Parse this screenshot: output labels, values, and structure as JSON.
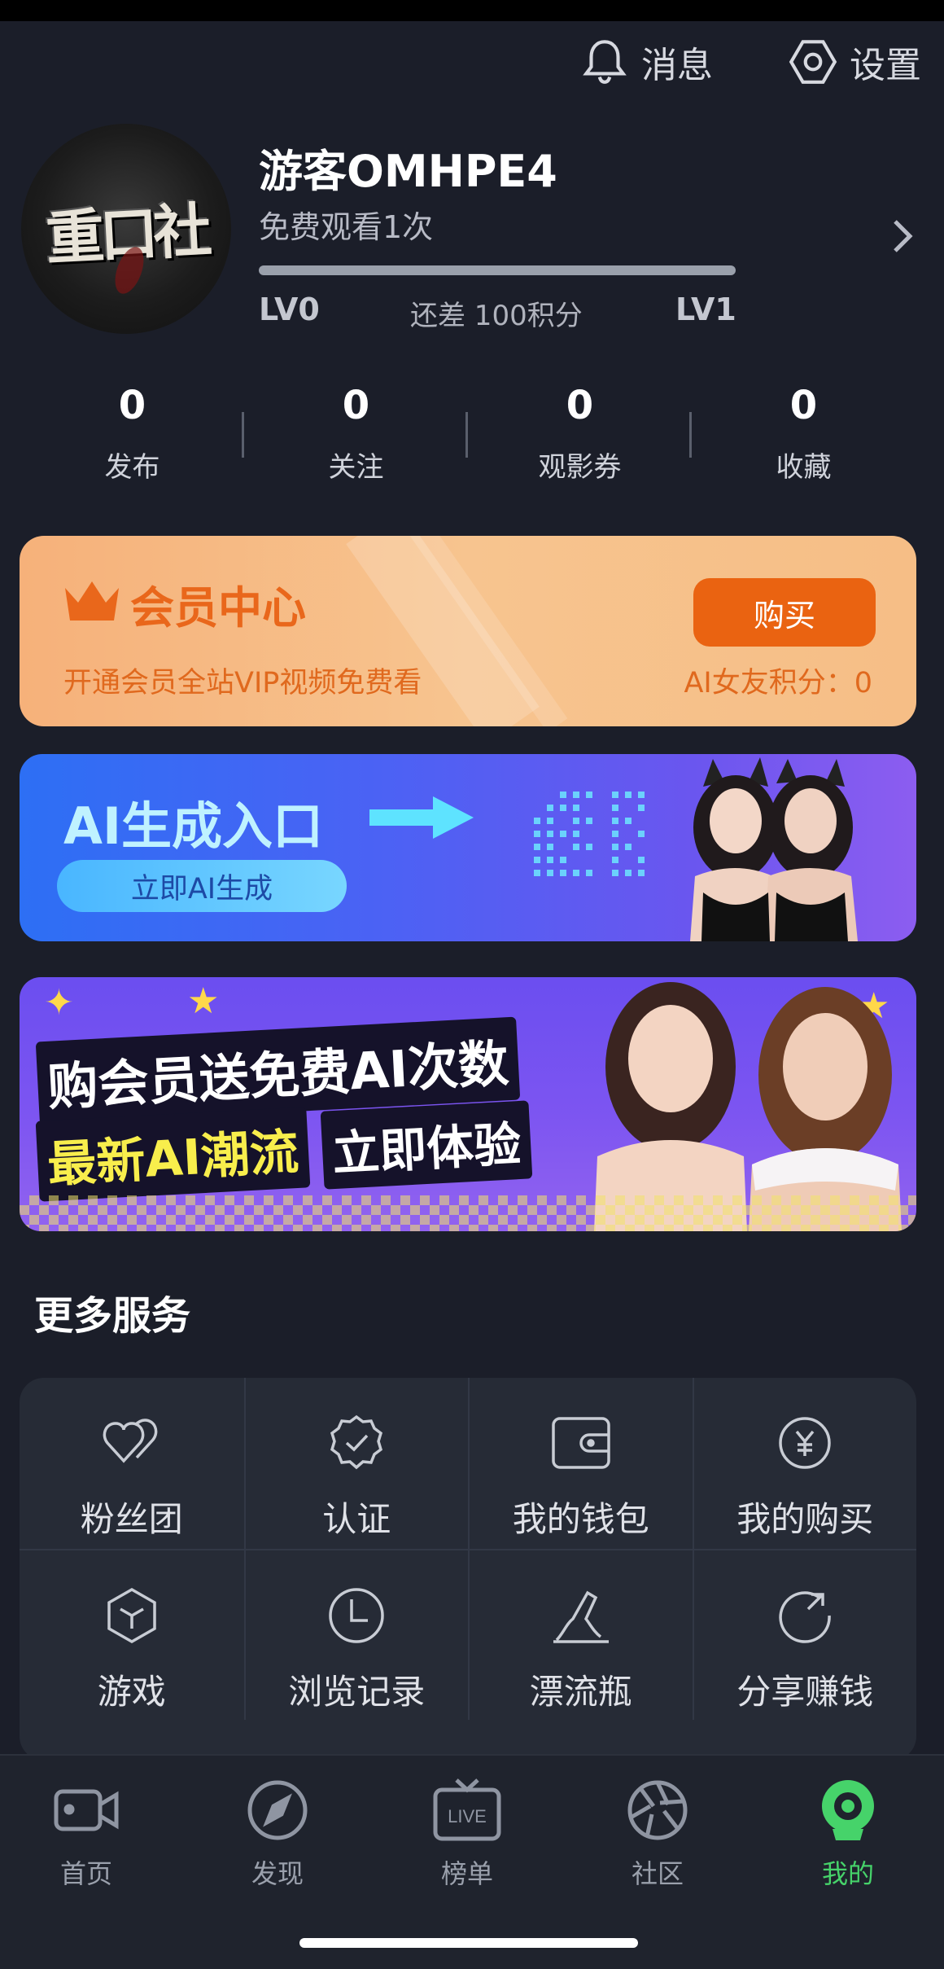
{
  "header": {
    "messages_label": "消息",
    "settings_label": "设置"
  },
  "profile": {
    "username": "游客OMHPE4",
    "free_views": "免费观看1次",
    "level_current": "LV0",
    "level_next": "LV1",
    "points_needed": "还差 100积分",
    "level_progress": 0,
    "avatar_text": "重口社"
  },
  "stats": [
    {
      "value": "0",
      "label": "发布"
    },
    {
      "value": "0",
      "label": "关注"
    },
    {
      "value": "0",
      "label": "观影券"
    },
    {
      "value": "0",
      "label": "收藏"
    }
  ],
  "vip": {
    "title": "会员中心",
    "subtitle": "开通会员全站VIP视频免费看",
    "buy_label": "购买",
    "ai_points": "AI女友积分：0"
  },
  "ai_banner": {
    "title": "AI生成入口",
    "button": "立即AI生成"
  },
  "promo": {
    "line1": "购会员送免费AI次数",
    "line2": "最新AI潮流",
    "line3": "立即体验"
  },
  "services": {
    "title": "更多服务",
    "items": [
      {
        "label": "粉丝团",
        "icon": "hearts-icon"
      },
      {
        "label": "认证",
        "icon": "verified-badge-icon"
      },
      {
        "label": "我的钱包",
        "icon": "wallet-icon"
      },
      {
        "label": "我的购买",
        "icon": "yen-coin-icon"
      },
      {
        "label": "游戏",
        "icon": "cube-icon"
      },
      {
        "label": "浏览记录",
        "icon": "clock-icon"
      },
      {
        "label": "漂流瓶",
        "icon": "drift-bottle-icon"
      },
      {
        "label": "分享赚钱",
        "icon": "share-refresh-icon"
      }
    ]
  },
  "tabbar": {
    "items": [
      {
        "label": "首页",
        "icon": "video-camera-icon"
      },
      {
        "label": "发现",
        "icon": "compass-icon"
      },
      {
        "label": "榜单",
        "icon": "live-tv-icon"
      },
      {
        "label": "社区",
        "icon": "aperture-icon"
      },
      {
        "label": "我的",
        "icon": "profile-webcam-icon",
        "active": true
      }
    ],
    "active_color": "#46d36a"
  },
  "colors": {
    "background": "#1b1e29",
    "vip_accent": "#ea6311",
    "ai_banner_start": "#2d6ff4",
    "ai_banner_end": "#8c5df0"
  }
}
